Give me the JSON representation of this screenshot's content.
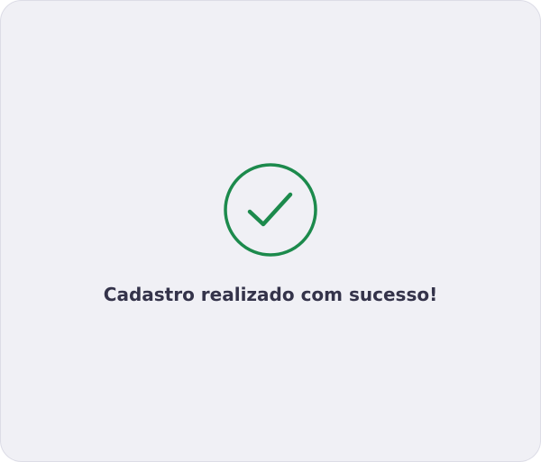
{
  "success": {
    "icon": "check-circle-icon",
    "message": "Cadastro realizado com sucesso!"
  },
  "colors": {
    "background": "#f0f0f5",
    "success_green": "#1c8a4c",
    "text": "#34334a"
  }
}
